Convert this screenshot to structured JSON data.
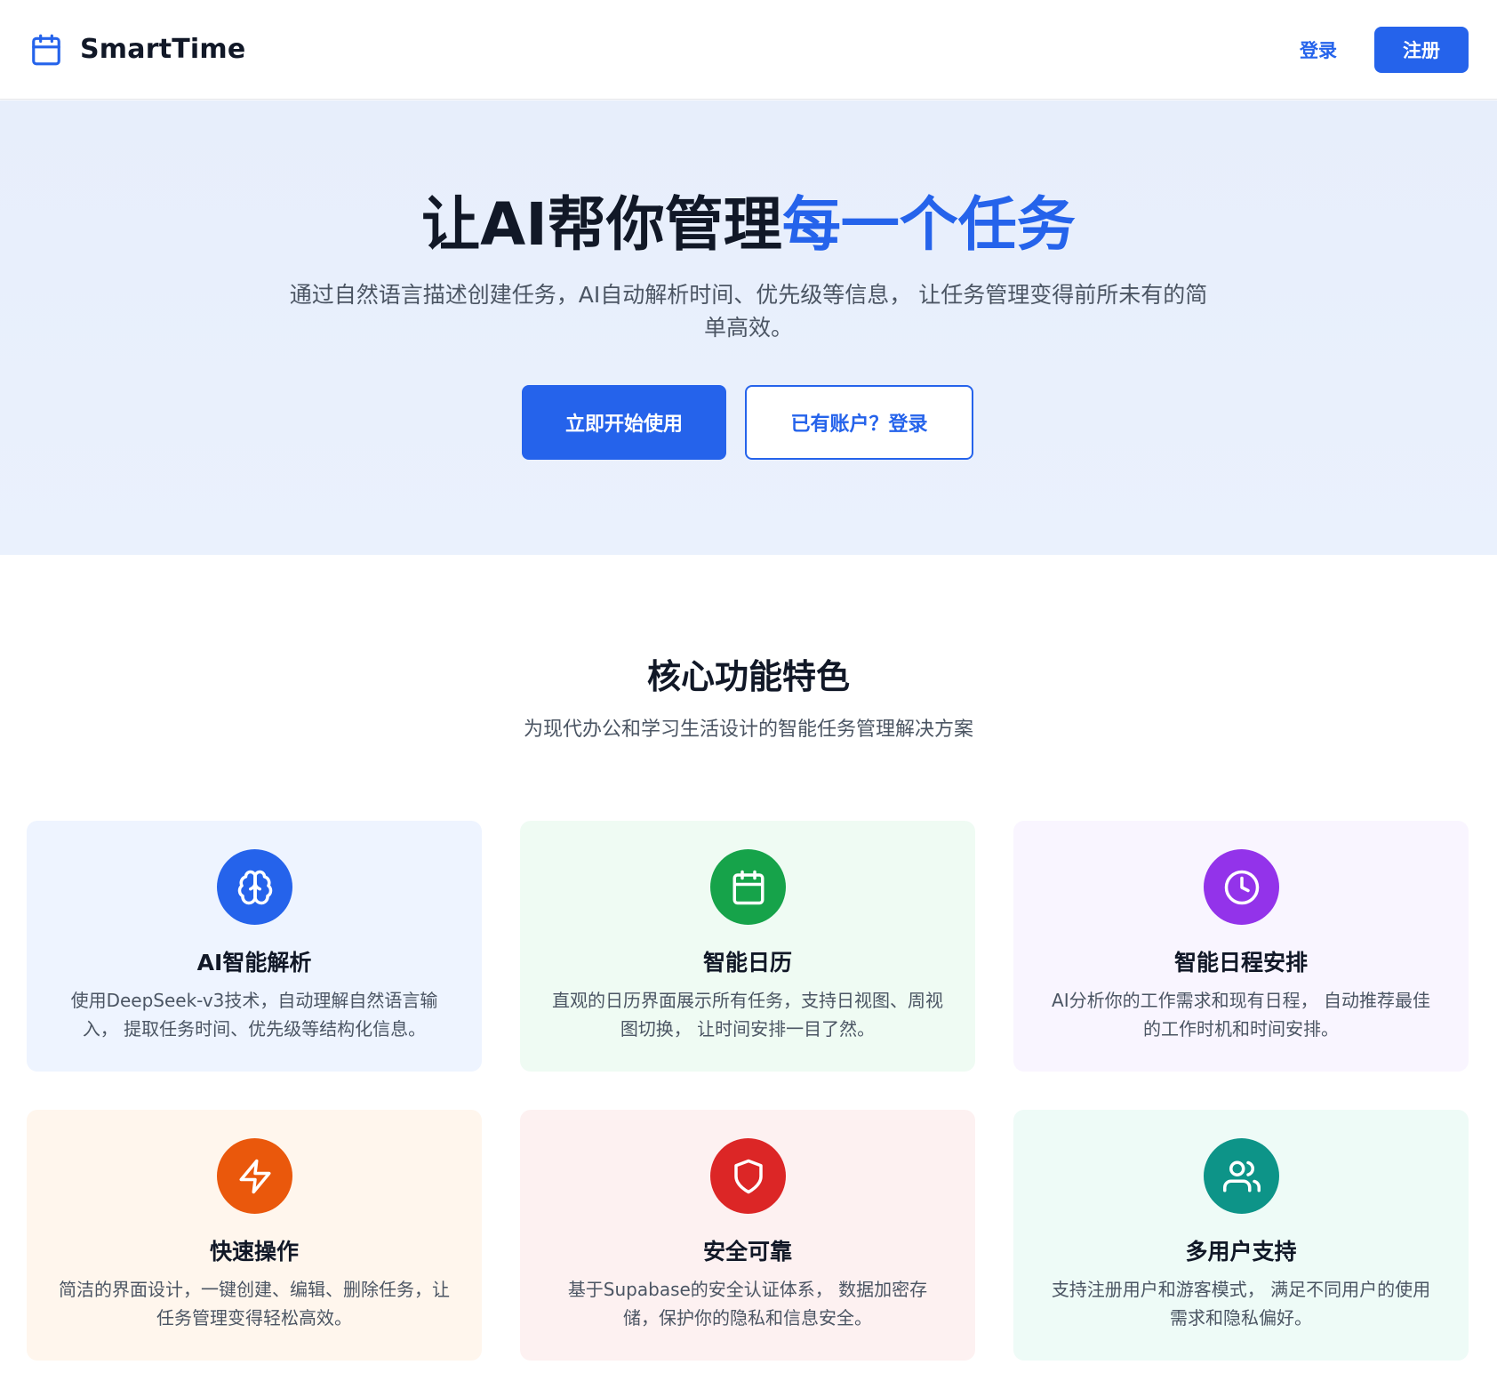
{
  "header": {
    "brand": "SmartTime",
    "login_label": "登录",
    "signup_label": "注册"
  },
  "hero": {
    "title_main": "让AI帮你管理",
    "title_accent": "每一个任务",
    "subtitle": "通过自然语言描述创建任务，AI自动解析时间、优先级等信息， 让任务管理变得前所未有的简单高效。",
    "primary_cta": "立即开始使用",
    "secondary_cta": "已有账户？登录"
  },
  "features": {
    "title": "核心功能特色",
    "subtitle": "为现代办公和学习生活设计的智能任务管理解决方案",
    "items": [
      {
        "icon": "brain-icon",
        "color": "#2563eb",
        "title": "AI智能解析",
        "desc": "使用DeepSeek-v3技术，自动理解自然语言输入， 提取任务时间、优先级等结构化信息。"
      },
      {
        "icon": "calendar-icon",
        "color": "#16a34a",
        "title": "智能日历",
        "desc": "直观的日历界面展示所有任务，支持日视图、周视图切换， 让时间安排一目了然。"
      },
      {
        "icon": "clock-icon",
        "color": "#9333ea",
        "title": "智能日程安排",
        "desc": "AI分析你的工作需求和现有日程， 自动推荐最佳的工作时机和时间安排。"
      },
      {
        "icon": "lightning-icon",
        "color": "#ea580c",
        "title": "快速操作",
        "desc": "简洁的界面设计，一键创建、编辑、删除任务，让任务管理变得轻松高效。"
      },
      {
        "icon": "shield-icon",
        "color": "#dc2626",
        "title": "安全可靠",
        "desc": "基于Supabase的安全认证体系， 数据加密存储，保护你的隐私和信息安全。"
      },
      {
        "icon": "users-icon",
        "color": "#0d9488",
        "title": "多用户支持",
        "desc": "支持注册用户和游客模式， 满足不同用户的使用需求和隐私偏好。"
      }
    ]
  },
  "colors": {
    "primary": "#2563eb",
    "hero_bg": "#e8effc"
  }
}
